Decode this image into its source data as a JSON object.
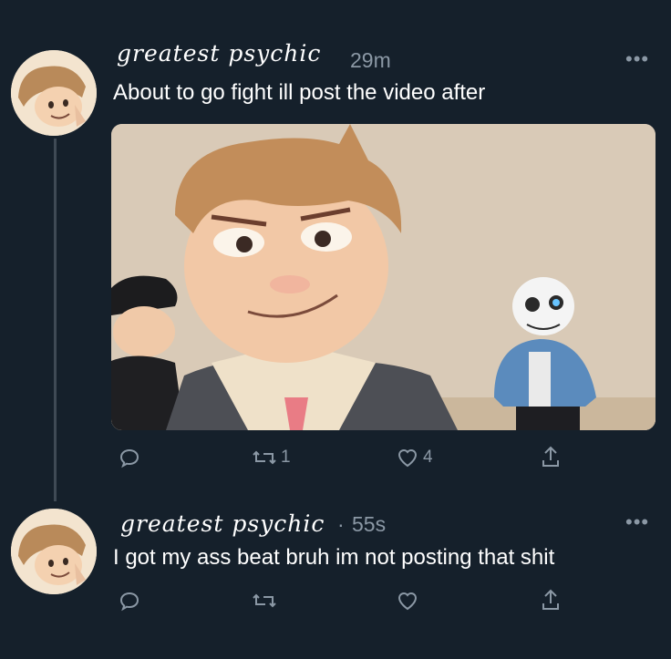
{
  "tweets": [
    {
      "name": "greatest psychic",
      "time": "29m",
      "text": "About to go fight ill post the video after",
      "more": "•••",
      "actions": {
        "replies": "",
        "retweets": "1",
        "likes": "4"
      }
    },
    {
      "name": "greatest psychic",
      "separator": "·",
      "time": "55s",
      "text": "I got my ass beat bruh im not posting that shit",
      "more": "•••",
      "actions": {
        "replies": "",
        "retweets": "",
        "likes": ""
      }
    }
  ],
  "colors": {
    "background": "#15202b",
    "secondary_text": "#8b98a5",
    "thread_line": "#3f4a55"
  },
  "icons": [
    "reply-icon",
    "retweet-icon",
    "like-icon",
    "share-icon",
    "more-icon"
  ]
}
